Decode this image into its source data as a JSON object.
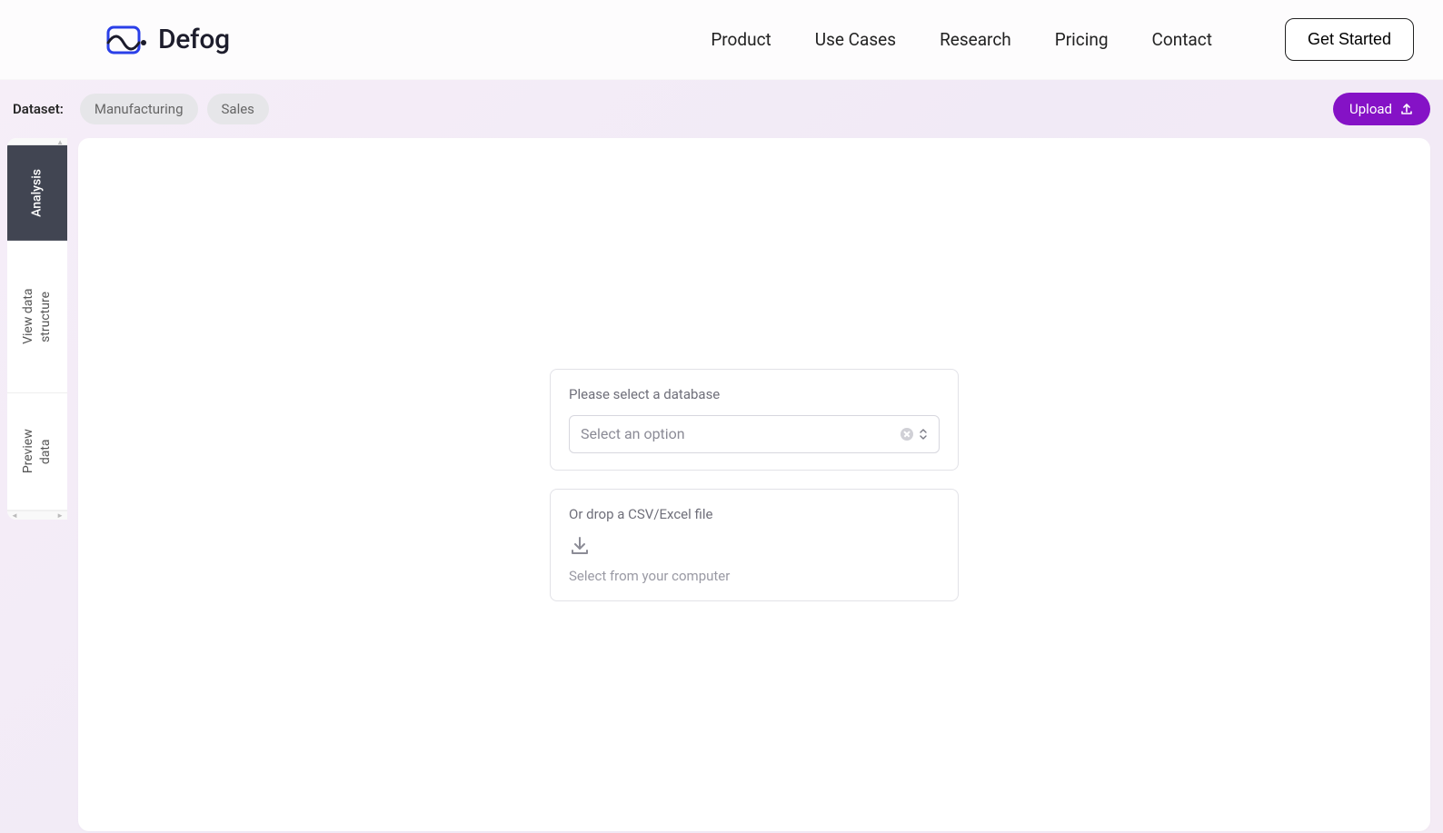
{
  "brand": {
    "name": "Defog"
  },
  "nav": {
    "items": [
      "Product",
      "Use Cases",
      "Research",
      "Pricing",
      "Contact"
    ],
    "cta": "Get Started"
  },
  "datasetBar": {
    "label": "Dataset:",
    "chips": [
      "Manufacturing",
      "Sales"
    ],
    "uploadLabel": "Upload"
  },
  "sideTabs": {
    "items": [
      "Analysis",
      "View data\nstructure",
      "Preview data"
    ],
    "activeIndex": 0
  },
  "dbPanel": {
    "label": "Please select a database",
    "placeholder": "Select an option"
  },
  "dropPanel": {
    "label": "Or drop a CSV/Excel file",
    "sub": "Select from your computer"
  }
}
